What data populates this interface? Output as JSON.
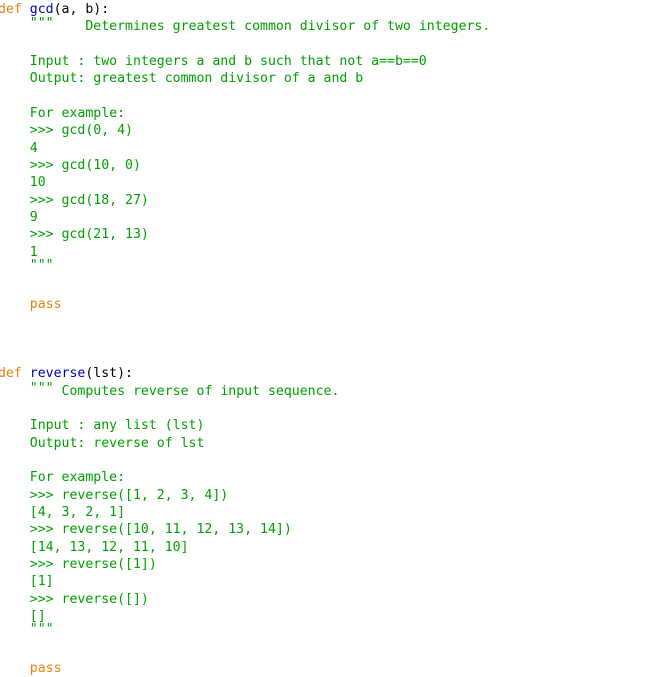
{
  "editor": {
    "name": "python-source-view",
    "language": "python",
    "background_color": "#ffffff",
    "colors": {
      "keyword": "#E8820C",
      "function_name": "#0000C0",
      "docstring": "#00A000",
      "default_text": "#000000"
    }
  },
  "code": {
    "lines": [
      {
        "id": "l1",
        "name": "def-gcd-signature",
        "segments": [
          {
            "text": "def ",
            "type": "keyword"
          },
          {
            "text": "gcd",
            "type": "function_name"
          },
          {
            "text": "(a, b):",
            "type": "punct"
          }
        ]
      },
      {
        "id": "l2",
        "name": "gcd-docstring-open",
        "segments": [
          {
            "text": "    ",
            "type": "punct"
          },
          {
            "text": "\"\"\"",
            "type": "quote_open"
          },
          {
            "text": "    Determines greatest common divisor of two integers.",
            "type": "docstring"
          }
        ]
      },
      {
        "id": "l3",
        "name": "blank-line",
        "segments": [
          {
            "text": "",
            "type": "docstring"
          }
        ]
      },
      {
        "id": "l4",
        "name": "gcd-doc-input",
        "segments": [
          {
            "text": "    Input : two integers a and b such that not a==b==0",
            "type": "docstring"
          }
        ]
      },
      {
        "id": "l5",
        "name": "gcd-doc-output",
        "segments": [
          {
            "text": "    Output: greatest common divisor of a and b",
            "type": "docstring"
          }
        ]
      },
      {
        "id": "l6",
        "name": "blank-line",
        "segments": [
          {
            "text": "",
            "type": "docstring"
          }
        ]
      },
      {
        "id": "l7",
        "name": "gcd-doc-for-example",
        "segments": [
          {
            "text": "    For example:",
            "type": "docstring"
          }
        ]
      },
      {
        "id": "l8",
        "name": "gcd-doctest-call-1",
        "segments": [
          {
            "text": "    >>> gcd(0, 4)",
            "type": "docstring"
          }
        ]
      },
      {
        "id": "l9",
        "name": "gcd-doctest-result-1",
        "segments": [
          {
            "text": "    4",
            "type": "docstring"
          }
        ]
      },
      {
        "id": "l10",
        "name": "gcd-doctest-call-2",
        "segments": [
          {
            "text": "    >>> gcd(10, 0)",
            "type": "docstring"
          }
        ]
      },
      {
        "id": "l11",
        "name": "gcd-doctest-result-2",
        "segments": [
          {
            "text": "    10",
            "type": "docstring"
          }
        ]
      },
      {
        "id": "l12",
        "name": "gcd-doctest-call-3",
        "segments": [
          {
            "text": "    >>> gcd(18, 27)",
            "type": "docstring"
          }
        ]
      },
      {
        "id": "l13",
        "name": "gcd-doctest-result-3",
        "segments": [
          {
            "text": "    9",
            "type": "docstring"
          }
        ]
      },
      {
        "id": "l14",
        "name": "gcd-doctest-call-4",
        "segments": [
          {
            "text": "    >>> gcd(21, 13)",
            "type": "docstring"
          }
        ]
      },
      {
        "id": "l15",
        "name": "gcd-doctest-result-4",
        "segments": [
          {
            "text": "    1",
            "type": "docstring"
          }
        ]
      },
      {
        "id": "l16",
        "name": "gcd-docstring-close",
        "segments": [
          {
            "text": "    ",
            "type": "punct"
          },
          {
            "text": "\"\"\"",
            "type": "quote_close"
          }
        ]
      },
      {
        "id": "l17",
        "name": "blank-line",
        "segments": [
          {
            "text": "",
            "type": "docstring"
          }
        ]
      },
      {
        "id": "l18",
        "name": "gcd-pass-statement",
        "segments": [
          {
            "text": "    ",
            "type": "punct"
          },
          {
            "text": "pass",
            "type": "keyword"
          }
        ]
      },
      {
        "id": "l19",
        "name": "blank-line",
        "segments": [
          {
            "text": "",
            "type": "docstring"
          }
        ]
      },
      {
        "id": "l20",
        "name": "blank-line",
        "segments": [
          {
            "text": "",
            "type": "docstring"
          }
        ]
      },
      {
        "id": "l21",
        "name": "blank-line",
        "segments": [
          {
            "text": "",
            "type": "docstring"
          }
        ]
      },
      {
        "id": "l22",
        "name": "def-reverse-signature",
        "segments": [
          {
            "text": "def ",
            "type": "keyword"
          },
          {
            "text": "reverse",
            "type": "function_name"
          },
          {
            "text": "(lst):",
            "type": "punct"
          }
        ]
      },
      {
        "id": "l23",
        "name": "reverse-docstring-open",
        "segments": [
          {
            "text": "    ",
            "type": "punct"
          },
          {
            "text": "\"\"\"",
            "type": "quote_open"
          },
          {
            "text": " Computes reverse of input sequence.",
            "type": "docstring"
          }
        ]
      },
      {
        "id": "l24",
        "name": "blank-line",
        "segments": [
          {
            "text": "",
            "type": "docstring"
          }
        ]
      },
      {
        "id": "l25",
        "name": "reverse-doc-input",
        "segments": [
          {
            "text": "    Input : any list (lst)",
            "type": "docstring"
          }
        ]
      },
      {
        "id": "l26",
        "name": "reverse-doc-output",
        "segments": [
          {
            "text": "    Output: reverse of lst",
            "type": "docstring"
          }
        ]
      },
      {
        "id": "l27",
        "name": "blank-line",
        "segments": [
          {
            "text": "",
            "type": "docstring"
          }
        ]
      },
      {
        "id": "l28",
        "name": "reverse-doc-for-example",
        "segments": [
          {
            "text": "    For example:",
            "type": "docstring"
          }
        ]
      },
      {
        "id": "l29",
        "name": "reverse-doctest-call-1",
        "segments": [
          {
            "text": "    >>> reverse([1, 2, 3, 4])",
            "type": "docstring"
          }
        ]
      },
      {
        "id": "l30",
        "name": "reverse-doctest-result-1",
        "segments": [
          {
            "text": "    [4, 3, 2, 1]",
            "type": "docstring"
          }
        ]
      },
      {
        "id": "l31",
        "name": "reverse-doctest-call-2",
        "segments": [
          {
            "text": "    >>> reverse([10, 11, 12, 13, 14])",
            "type": "docstring"
          }
        ]
      },
      {
        "id": "l32",
        "name": "reverse-doctest-result-2",
        "segments": [
          {
            "text": "    [14, 13, 12, 11, 10]",
            "type": "docstring"
          }
        ]
      },
      {
        "id": "l33",
        "name": "reverse-doctest-call-3",
        "segments": [
          {
            "text": "    >>> reverse([1])",
            "type": "docstring"
          }
        ]
      },
      {
        "id": "l34",
        "name": "reverse-doctest-result-3",
        "segments": [
          {
            "text": "    [1]",
            "type": "docstring"
          }
        ]
      },
      {
        "id": "l35",
        "name": "reverse-doctest-call-4",
        "segments": [
          {
            "text": "    >>> reverse([])",
            "type": "docstring"
          }
        ]
      },
      {
        "id": "l36",
        "name": "reverse-doctest-result-4",
        "segments": [
          {
            "text": "    []",
            "type": "docstring"
          }
        ]
      },
      {
        "id": "l37",
        "name": "reverse-docstring-close",
        "segments": [
          {
            "text": "    ",
            "type": "punct"
          },
          {
            "text": "\"\"\"",
            "type": "quote_close"
          }
        ]
      },
      {
        "id": "l38",
        "name": "blank-line",
        "segments": [
          {
            "text": "",
            "type": "docstring"
          }
        ]
      },
      {
        "id": "l39",
        "name": "reverse-pass-statement",
        "segments": [
          {
            "text": "    ",
            "type": "punct"
          },
          {
            "text": "pass",
            "type": "keyword"
          }
        ]
      }
    ]
  }
}
